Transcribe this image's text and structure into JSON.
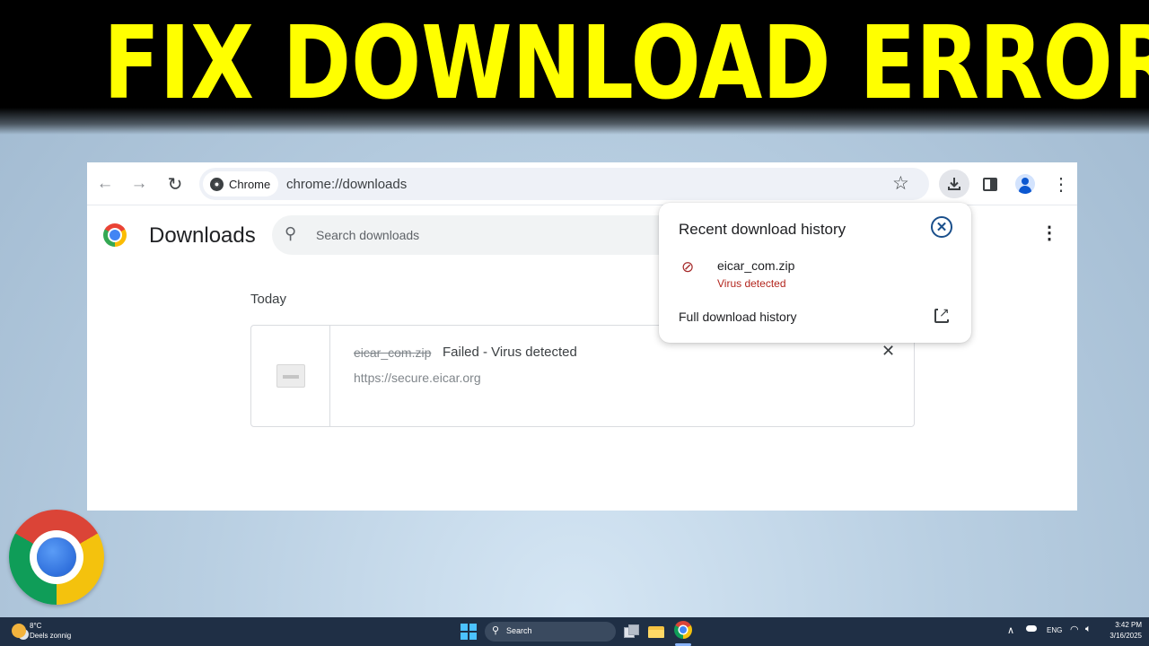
{
  "banner": {
    "title": "FIX DOWNLOAD ERROR"
  },
  "browser": {
    "back_icon": "arrow-left-icon",
    "forward_icon": "arrow-right-icon",
    "reload_icon": "reload-icon",
    "omnibox": {
      "chip_label": "Chrome",
      "url": "chrome://downloads"
    },
    "toolbar_icons": [
      "star-icon",
      "download-icon",
      "side-panel-icon",
      "profile-icon",
      "more-vert-icon"
    ]
  },
  "page": {
    "title": "Downloads",
    "search": {
      "placeholder": "Search downloads"
    },
    "section_label": "Today",
    "downloads": [
      {
        "filename": "eicar_com.zip",
        "status": "Failed - Virus detected",
        "url": "https://secure.eicar.org"
      }
    ]
  },
  "popup": {
    "title": "Recent download history",
    "item": {
      "filename": "eicar_com.zip",
      "status": "Virus detected"
    },
    "full_history_label": "Full download history"
  },
  "taskbar": {
    "weather": {
      "temp": "8°C",
      "desc": "Deels zonnig"
    },
    "search_label": "Search",
    "language": "ENG",
    "time": "3:42 PM",
    "date": "3/16/2025"
  },
  "colors": {
    "banner_text": "#ffff00",
    "banner_bg": "#000000",
    "warning": "#b3261e",
    "taskbar": "#1f2f45"
  }
}
